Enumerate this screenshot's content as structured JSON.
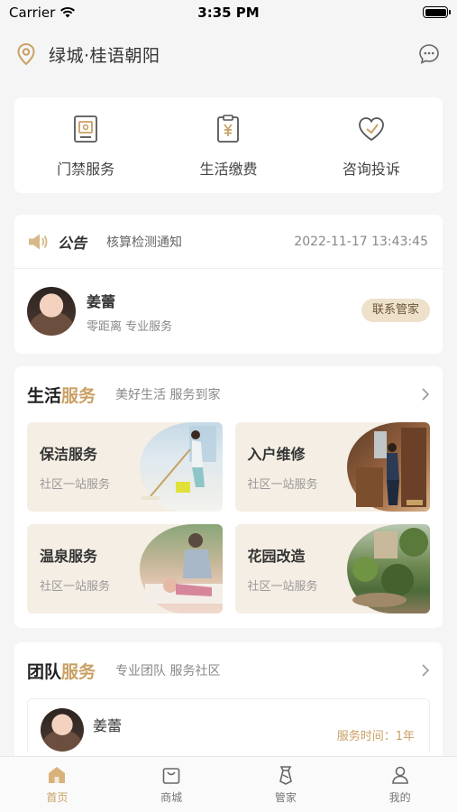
{
  "status_bar": {
    "carrier": "Carrier",
    "time": "3:35 PM"
  },
  "header": {
    "title": "绿城·桂语朝阳",
    "location_icon": "location-pin-icon",
    "message_icon": "chat-bubble-icon"
  },
  "quick_actions": [
    {
      "label": "门禁服务",
      "icon": "door-access-icon"
    },
    {
      "label": "生活缴费",
      "icon": "bill-payment-icon"
    },
    {
      "label": "咨询投诉",
      "icon": "heart-consult-icon"
    }
  ],
  "notice": {
    "tag": "公告",
    "text": "核算检测通知",
    "date": "2022-11-17 13:43:45",
    "manager_name": "姜蕾",
    "manager_sub": "零距离 专业服务",
    "contact_label": "联系管家"
  },
  "life_services": {
    "title_a": "生活",
    "title_b": "服务",
    "desc": "美好生活 服务到家",
    "items": [
      {
        "title": "保洁服务",
        "sub": "社区一站服务"
      },
      {
        "title": "入户维修",
        "sub": "社区一站服务"
      },
      {
        "title": "温泉服务",
        "sub": "社区一站服务"
      },
      {
        "title": "花园改造",
        "sub": "社区一站服务"
      }
    ]
  },
  "team_services": {
    "title_a": "团队",
    "title_b": "服务",
    "desc": "专业团队 服务社区",
    "member_name": "姜蕾",
    "member_time": "服务时间：1年"
  },
  "tabbar": [
    {
      "label": "首页",
      "active": true,
      "icon": "home-icon"
    },
    {
      "label": "商城",
      "active": false,
      "icon": "shop-bag-icon"
    },
    {
      "label": "管家",
      "active": false,
      "icon": "butler-tie-icon"
    },
    {
      "label": "我的",
      "active": false,
      "icon": "profile-icon"
    }
  ],
  "colors": {
    "accent": "#c9a063",
    "card_bg": "#f5eee4",
    "contact_bg": "#ede1cc"
  }
}
